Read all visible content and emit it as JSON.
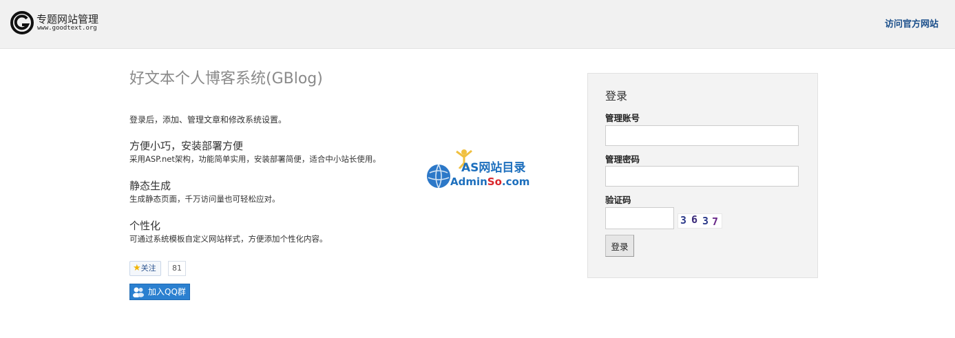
{
  "header": {
    "logo_title": "专题网站管理",
    "logo_url": "www.goodtext.org",
    "official_link": "访问官方网站"
  },
  "main": {
    "title": "好文本个人博客系统(GBlog)",
    "intro": "登录后，添加、管理文章和修改系统设置。",
    "features": [
      {
        "title": "方便小巧，安装部署方便",
        "desc": "采用ASP.net架构，功能简单实用，安装部署简便，适合中小站长使用。"
      },
      {
        "title": "静态生成",
        "desc": "生成静态页面，千万访问量也可轻松应对。"
      },
      {
        "title": "个性化",
        "desc": "可通过系统模板自定义网站样式，方便添加个性化内容。"
      }
    ],
    "follow_label": "关注",
    "follow_count": "81",
    "qq_group_label": "加入QQ群"
  },
  "watermark": {
    "line1": "AS网站目录",
    "line2_a": "Admin",
    "line2_b": "So",
    "line2_c": ".com"
  },
  "login": {
    "title": "登录",
    "username_label": "管理账号",
    "username_value": "",
    "password_label": "管理密码",
    "password_value": "",
    "captcha_label": "验证码",
    "captcha_value": "",
    "captcha_digits": [
      "3",
      "6",
      "3",
      "7"
    ],
    "submit_label": "登录"
  },
  "colors": {
    "header_bg": "#f1f1f1",
    "link": "#1a4e8a",
    "title_gray": "#8a8a8a",
    "login_bg": "#f3f3f3",
    "qq_blue": "#2b80d0"
  }
}
